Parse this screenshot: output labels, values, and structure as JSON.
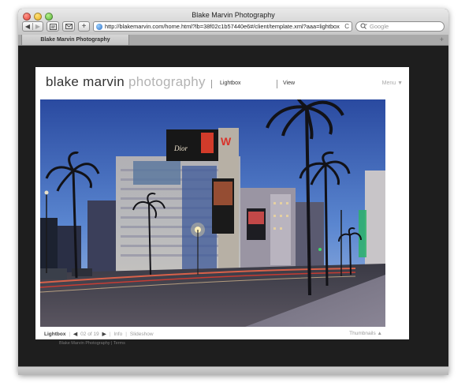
{
  "browser": {
    "window_title": "Blake Marvin Photography",
    "url": "http://blakemarvin.com/home.html?lb=38f02c1b57440e6#/client/template.xml?aaa=lightbox",
    "search_placeholder": "Google",
    "tab_label": "Blake Marvin Photography",
    "back_glyph": "◀",
    "forward_glyph": "▶",
    "reload_glyph": "C",
    "add_glyph": "+",
    "tab_add_glyph": "+"
  },
  "site": {
    "logo_primary": "blake marvin",
    "logo_secondary": "photography",
    "nav": {
      "lightbox": "Lightbox",
      "view": "View",
      "menu": "Menu ▼"
    }
  },
  "viewer": {
    "label": "Lightbox",
    "prev_glyph": "◀",
    "counter": "02 of 19",
    "next_glyph": "▶",
    "info": "Info",
    "slideshow": "Slideshow",
    "thumbnails": "Thumbnails ▲",
    "separator": "|"
  },
  "footer": {
    "text": "Blake Marvin Photography | Terms"
  },
  "photo": {
    "billboard_letter": "W"
  }
}
